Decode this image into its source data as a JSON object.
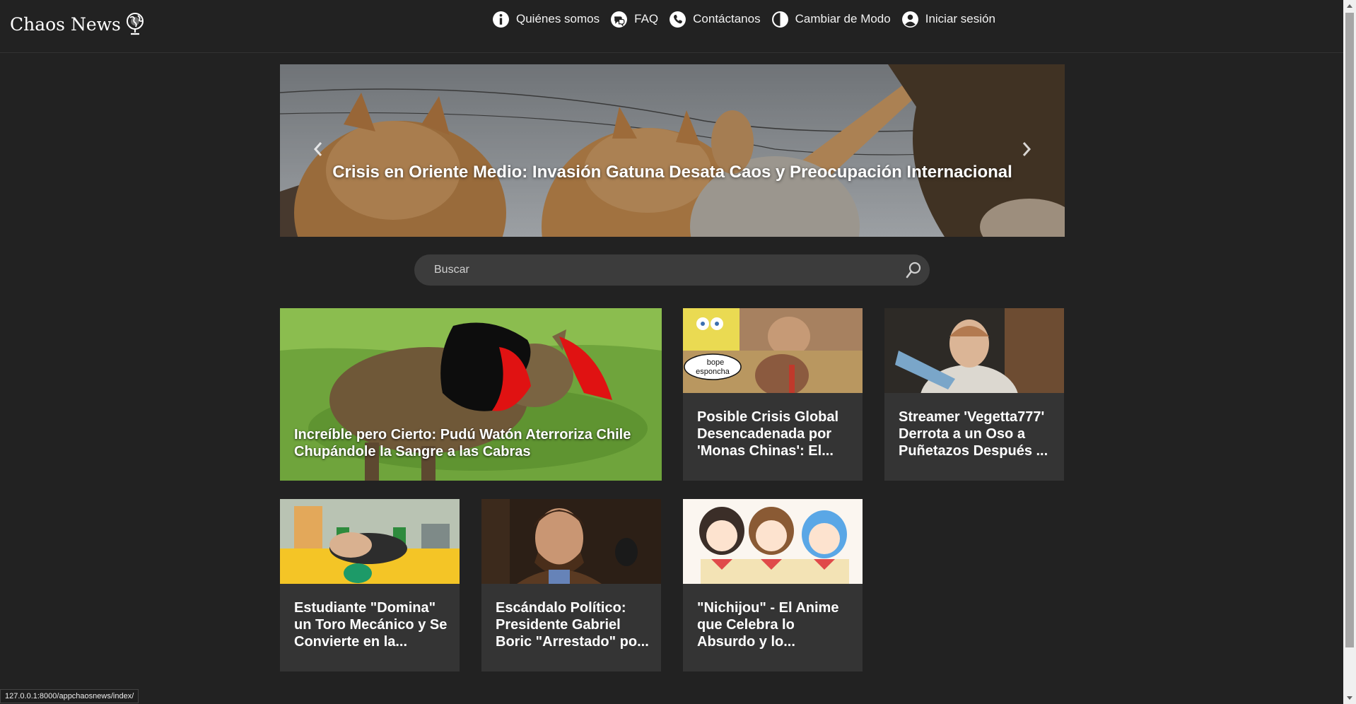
{
  "header": {
    "brand": "Chaos News",
    "nav": [
      {
        "label": "Quiénes somos",
        "icon": "info-icon"
      },
      {
        "label": "FAQ",
        "icon": "faq-icon"
      },
      {
        "label": "Contáctanos",
        "icon": "phone-icon"
      },
      {
        "label": "Cambiar de Modo",
        "icon": "contrast-icon"
      },
      {
        "label": "Iniciar sesión",
        "icon": "user-icon"
      }
    ]
  },
  "carousel": {
    "caption": "Crisis en Oriente Medio: Invasión Gatuna Desata Caos y Preocupación Internacional"
  },
  "search": {
    "placeholder": "Buscar"
  },
  "articles": [
    {
      "title": "Increíble pero Cierto: Pudú Watón Aterroriza Chile Chupándole la Sangre a las Cabras"
    },
    {
      "title": "Posible Crisis Global Desencadenada por 'Monas Chinas': El..."
    },
    {
      "title": "Streamer 'Vegetta777' Derrota a un Oso a Puñetazos Después ..."
    },
    {
      "title": "Estudiante \"Domina\" un Toro Mecánico y Se Convierte en la..."
    },
    {
      "title": "Escándalo Político: Presidente Gabriel Boric \"Arrestado\" po..."
    },
    {
      "title": "\"Nichijou\" - El Anime que Celebra lo Absurdo y lo..."
    }
  ],
  "thumb_texts": {
    "speech_bubble": "bope esponcha"
  },
  "status_url": "127.0.0.1:8000/appchaosnews/index/"
}
